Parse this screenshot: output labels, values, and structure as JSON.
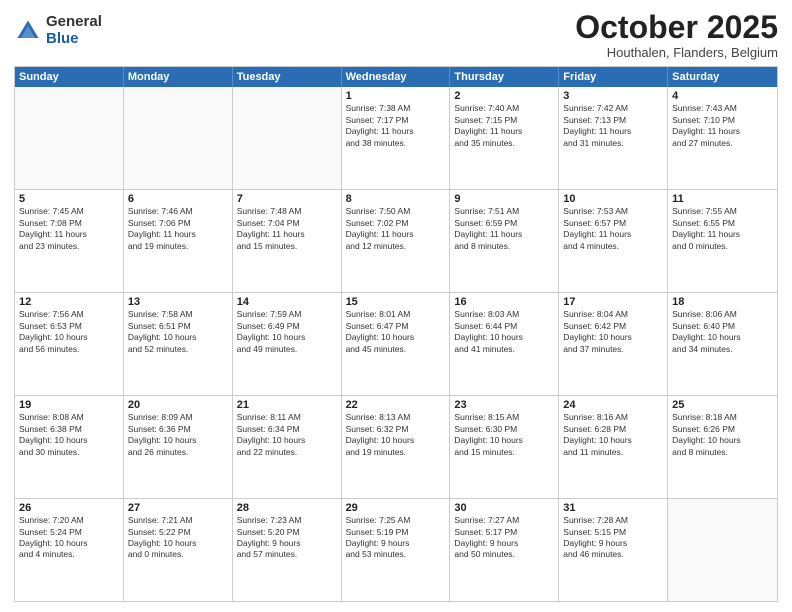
{
  "header": {
    "logo_general": "General",
    "logo_blue": "Blue",
    "month_title": "October 2025",
    "subtitle": "Houthalen, Flanders, Belgium"
  },
  "weekdays": [
    "Sunday",
    "Monday",
    "Tuesday",
    "Wednesday",
    "Thursday",
    "Friday",
    "Saturday"
  ],
  "rows": [
    [
      {
        "day": "",
        "info": ""
      },
      {
        "day": "",
        "info": ""
      },
      {
        "day": "",
        "info": ""
      },
      {
        "day": "1",
        "info": "Sunrise: 7:38 AM\nSunset: 7:17 PM\nDaylight: 11 hours\nand 38 minutes."
      },
      {
        "day": "2",
        "info": "Sunrise: 7:40 AM\nSunset: 7:15 PM\nDaylight: 11 hours\nand 35 minutes."
      },
      {
        "day": "3",
        "info": "Sunrise: 7:42 AM\nSunset: 7:13 PM\nDaylight: 11 hours\nand 31 minutes."
      },
      {
        "day": "4",
        "info": "Sunrise: 7:43 AM\nSunset: 7:10 PM\nDaylight: 11 hours\nand 27 minutes."
      }
    ],
    [
      {
        "day": "5",
        "info": "Sunrise: 7:45 AM\nSunset: 7:08 PM\nDaylight: 11 hours\nand 23 minutes."
      },
      {
        "day": "6",
        "info": "Sunrise: 7:46 AM\nSunset: 7:06 PM\nDaylight: 11 hours\nand 19 minutes."
      },
      {
        "day": "7",
        "info": "Sunrise: 7:48 AM\nSunset: 7:04 PM\nDaylight: 11 hours\nand 15 minutes."
      },
      {
        "day": "8",
        "info": "Sunrise: 7:50 AM\nSunset: 7:02 PM\nDaylight: 11 hours\nand 12 minutes."
      },
      {
        "day": "9",
        "info": "Sunrise: 7:51 AM\nSunset: 6:59 PM\nDaylight: 11 hours\nand 8 minutes."
      },
      {
        "day": "10",
        "info": "Sunrise: 7:53 AM\nSunset: 6:57 PM\nDaylight: 11 hours\nand 4 minutes."
      },
      {
        "day": "11",
        "info": "Sunrise: 7:55 AM\nSunset: 6:55 PM\nDaylight: 11 hours\nand 0 minutes."
      }
    ],
    [
      {
        "day": "12",
        "info": "Sunrise: 7:56 AM\nSunset: 6:53 PM\nDaylight: 10 hours\nand 56 minutes."
      },
      {
        "day": "13",
        "info": "Sunrise: 7:58 AM\nSunset: 6:51 PM\nDaylight: 10 hours\nand 52 minutes."
      },
      {
        "day": "14",
        "info": "Sunrise: 7:59 AM\nSunset: 6:49 PM\nDaylight: 10 hours\nand 49 minutes."
      },
      {
        "day": "15",
        "info": "Sunrise: 8:01 AM\nSunset: 6:47 PM\nDaylight: 10 hours\nand 45 minutes."
      },
      {
        "day": "16",
        "info": "Sunrise: 8:03 AM\nSunset: 6:44 PM\nDaylight: 10 hours\nand 41 minutes."
      },
      {
        "day": "17",
        "info": "Sunrise: 8:04 AM\nSunset: 6:42 PM\nDaylight: 10 hours\nand 37 minutes."
      },
      {
        "day": "18",
        "info": "Sunrise: 8:06 AM\nSunset: 6:40 PM\nDaylight: 10 hours\nand 34 minutes."
      }
    ],
    [
      {
        "day": "19",
        "info": "Sunrise: 8:08 AM\nSunset: 6:38 PM\nDaylight: 10 hours\nand 30 minutes."
      },
      {
        "day": "20",
        "info": "Sunrise: 8:09 AM\nSunset: 6:36 PM\nDaylight: 10 hours\nand 26 minutes."
      },
      {
        "day": "21",
        "info": "Sunrise: 8:11 AM\nSunset: 6:34 PM\nDaylight: 10 hours\nand 22 minutes."
      },
      {
        "day": "22",
        "info": "Sunrise: 8:13 AM\nSunset: 6:32 PM\nDaylight: 10 hours\nand 19 minutes."
      },
      {
        "day": "23",
        "info": "Sunrise: 8:15 AM\nSunset: 6:30 PM\nDaylight: 10 hours\nand 15 minutes."
      },
      {
        "day": "24",
        "info": "Sunrise: 8:16 AM\nSunset: 6:28 PM\nDaylight: 10 hours\nand 11 minutes."
      },
      {
        "day": "25",
        "info": "Sunrise: 8:18 AM\nSunset: 6:26 PM\nDaylight: 10 hours\nand 8 minutes."
      }
    ],
    [
      {
        "day": "26",
        "info": "Sunrise: 7:20 AM\nSunset: 5:24 PM\nDaylight: 10 hours\nand 4 minutes."
      },
      {
        "day": "27",
        "info": "Sunrise: 7:21 AM\nSunset: 5:22 PM\nDaylight: 10 hours\nand 0 minutes."
      },
      {
        "day": "28",
        "info": "Sunrise: 7:23 AM\nSunset: 5:20 PM\nDaylight: 9 hours\nand 57 minutes."
      },
      {
        "day": "29",
        "info": "Sunrise: 7:25 AM\nSunset: 5:19 PM\nDaylight: 9 hours\nand 53 minutes."
      },
      {
        "day": "30",
        "info": "Sunrise: 7:27 AM\nSunset: 5:17 PM\nDaylight: 9 hours\nand 50 minutes."
      },
      {
        "day": "31",
        "info": "Sunrise: 7:28 AM\nSunset: 5:15 PM\nDaylight: 9 hours\nand 46 minutes."
      },
      {
        "day": "",
        "info": ""
      }
    ]
  ]
}
